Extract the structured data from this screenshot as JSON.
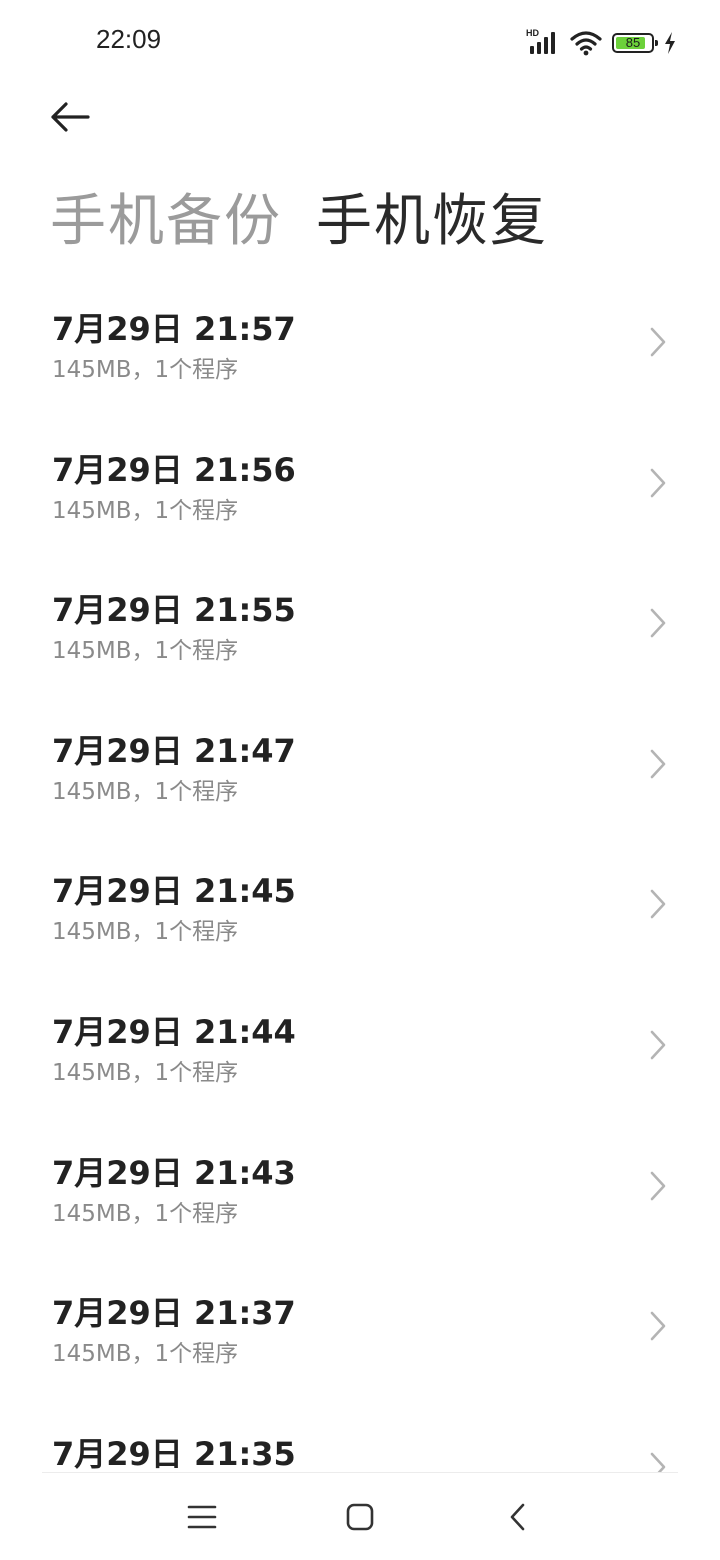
{
  "status_bar": {
    "time": "22:09",
    "network_badge": "HD",
    "battery_percent": "85",
    "battery_level": 0.85,
    "icons": [
      "signal-icon",
      "wifi-icon",
      "battery-icon",
      "charging-icon"
    ]
  },
  "header": {
    "back_icon": "arrow-left-icon",
    "tabs": [
      {
        "label": "手机备份",
        "active": false
      },
      {
        "label": "手机恢复",
        "active": true
      }
    ]
  },
  "backups": [
    {
      "title": "7月29日 21:57",
      "subtitle": "145MB，1个程序"
    },
    {
      "title": "7月29日 21:56",
      "subtitle": "145MB，1个程序"
    },
    {
      "title": "7月29日 21:55",
      "subtitle": "145MB，1个程序"
    },
    {
      "title": "7月29日 21:47",
      "subtitle": "145MB，1个程序"
    },
    {
      "title": "7月29日 21:45",
      "subtitle": "145MB，1个程序"
    },
    {
      "title": "7月29日 21:44",
      "subtitle": "145MB，1个程序"
    },
    {
      "title": "7月29日 21:43",
      "subtitle": "145MB，1个程序"
    },
    {
      "title": "7月29日 21:37",
      "subtitle": "145MB，1个程序"
    },
    {
      "title": "7月29日 21:35",
      "subtitle": ""
    }
  ],
  "nav_bar": {
    "icons": [
      "menu-icon",
      "home-icon",
      "back-icon"
    ]
  },
  "colors": {
    "accent_battery": "#6cd13a",
    "text_primary": "#222222",
    "text_secondary": "#8a8a8a",
    "tab_inactive": "#9b9b9b"
  }
}
